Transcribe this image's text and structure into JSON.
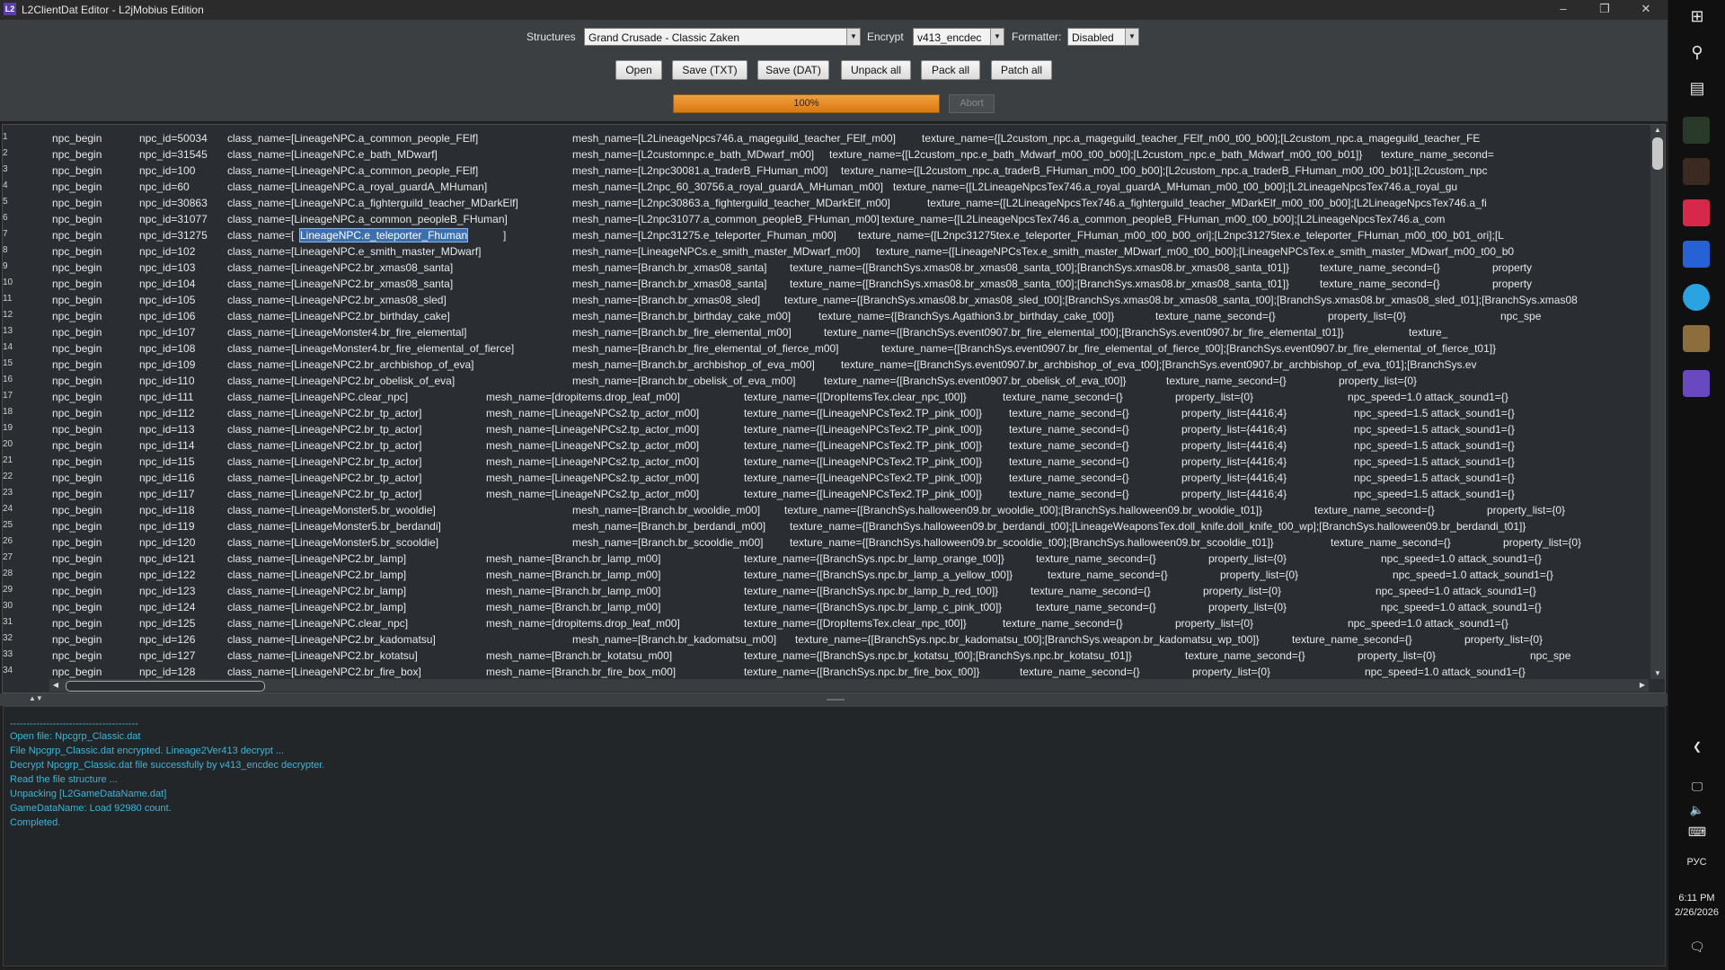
{
  "window": {
    "title": "L2ClientDat Editor - L2jMobius Edition",
    "app_icon": "L2",
    "controls": {
      "minimize": "–",
      "maximize": "❐",
      "close": "✕"
    }
  },
  "toolbar": {
    "structures_label": "Structures",
    "structures_value": "Grand Crusade - Classic Zaken",
    "encrypt_label": "Encrypt",
    "encrypt_value": "v413_encdec",
    "formatter_label": "Formatter:",
    "formatter_value": "Disabled",
    "buttons": [
      "Open",
      "Save (TXT)",
      "Save (DAT)",
      "Unpack all",
      "Pack all",
      "Patch all"
    ],
    "progress_percent": 100,
    "progress_text": "100%",
    "abort_label": "Abort"
  },
  "editor": {
    "highlight_line": 8,
    "highlight_text": "LineageNPC.e_teleporter_Fhuman",
    "lines": [
      {
        "n": "1",
        "a": "npc_begin",
        "b": "npc_id=50034",
        "c": "class_name=[LineageNPC.a_common_people_FElf]",
        "d": "mesh_name=[L2LineageNpcs746.a_mageguild_teacher_FElf_m00]",
        "e": "texture_name={[L2custom_npc.a_mageguild_teacher_FElf_m00_t00_b00];[L2custom_npc.a_mageguild_teacher_FE"
      },
      {
        "n": "2",
        "a": "npc_begin",
        "b": "npc_id=31545",
        "c": "class_name=[LineageNPC.e_bath_MDwarf]",
        "d": "mesh_name=[L2customnpc.e_bath_MDwarf_m00]",
        "e": "texture_name={[L2custom_npc.e_bath_Mdwarf_m00_t00_b00];[L2custom_npc.e_bath_Mdwarf_m00_t00_b01]}",
        "f": "texture_name_second="
      },
      {
        "n": "3",
        "a": "npc_begin",
        "b": "npc_id=100",
        "c": "class_name=[LineageNPC.a_common_people_FElf]",
        "d": "mesh_name=[L2npc30081.a_traderB_FHuman_m00]",
        "e": "texture_name={[L2custom_npc.a_traderB_FHuman_m00_t00_b00];[L2custom_npc.a_traderB_FHuman_m00_t00_b01];[L2custom_npc"
      },
      {
        "n": "4",
        "a": "npc_begin",
        "b": "npc_id=60",
        "c": "class_name=[LineageNPC.a_royal_guardA_MHuman]",
        "d": "mesh_name=[L2npc_60_30756.a_royal_guardA_MHuman_m00]",
        "e": "texture_name={[L2LineageNpcsTex746.a_royal_guardA_MHuman_m00_t00_b00];[L2LineageNpcsTex746.a_royal_gu"
      },
      {
        "n": "5",
        "a": "npc_begin",
        "b": "npc_id=30863",
        "c": "class_name=[LineageNPC.a_fighterguild_teacher_MDarkElf]",
        "d": "mesh_name=[L2npc30863.a_fighterguild_teacher_MDarkElf_m00]",
        "e": "texture_name={[L2LineageNpcsTex746.a_fighterguild_teacher_MDarkElf_m00_t00_b00];[L2LineageNpcsTex746.a_fi"
      },
      {
        "n": "6",
        "a": "npc_begin",
        "b": "npc_id=31077",
        "c": "class_name=[LineageNPC.a_common_peopleB_FHuman]",
        "d": "mesh_name=[L2npc31077.a_common_peopleB_FHuman_m00]",
        "e": "texture_name={[L2LineageNpcsTex746.a_common_peopleB_FHuman_m00_t00_b00];[L2LineageNpcsTex746.a_com"
      },
      {
        "n": "7",
        "a": "npc_begin",
        "b": "npc_id=31275",
        "c": "class_name=[",
        "h": "LineageNPC.e_teleporter_Fhuman",
        "c2": "]",
        "d": "mesh_name=[L2npc31275.e_teleporter_Fhuman_m00]",
        "e": "texture_name={[L2npc31275tex.e_teleporter_FHuman_m00_t00_b00_ori];[L2npc31275tex.e_teleporter_FHuman_m00_t00_b01_ori];[L"
      },
      {
        "n": "8",
        "a": "npc_begin",
        "b": "npc_id=102",
        "c": "class_name=[LineageNPC.e_smith_master_MDwarf]",
        "d": "mesh_name=[LineageNPCs.e_smith_master_MDwarf_m00]",
        "e": "texture_name={[LineageNPCsTex.e_smith_master_MDwarf_m00_t00_b00];[LineageNPCsTex.e_smith_master_MDwarf_m00_t00_b0"
      },
      {
        "n": "9",
        "a": "npc_begin",
        "b": "npc_id=103",
        "c": "class_name=[LineageNPC2.br_xmas08_santa]",
        "d": "mesh_name=[Branch.br_xmas08_santa]",
        "e": "texture_name={[BranchSys.xmas08.br_xmas08_santa_t00];[BranchSys.xmas08.br_xmas08_santa_t01]}",
        "f": "texture_name_second={}",
        "g": "property"
      },
      {
        "n": "10",
        "a": "npc_begin",
        "b": "npc_id=104",
        "c": "class_name=[LineageNPC2.br_xmas08_santa]",
        "d": "mesh_name=[Branch.br_xmas08_santa]",
        "e": "texture_name={[BranchSys.xmas08.br_xmas08_santa_t00];[BranchSys.xmas08.br_xmas08_santa_t01]}",
        "f": "texture_name_second={}",
        "g": "property"
      },
      {
        "n": "11",
        "a": "npc_begin",
        "b": "npc_id=105",
        "c": "class_name=[LineageNPC2.br_xmas08_sled]",
        "d": "mesh_name=[Branch.br_xmas08_sled]",
        "e": "texture_name={[BranchSys.xmas08.br_xmas08_sled_t00];[BranchSys.xmas08.br_xmas08_santa_t00];[BranchSys.xmas08.br_xmas08_sled_t01];[BranchSys.xmas08"
      },
      {
        "n": "12",
        "a": "npc_begin",
        "b": "npc_id=106",
        "c": "class_name=[LineageNPC2.br_birthday_cake]",
        "d": "mesh_name=[Branch.br_birthday_cake_m00]",
        "e": "texture_name={[BranchSys.Agathion3.br_birthday_cake_t00]}",
        "f": "texture_name_second={}",
        "g": "property_list={0}",
        "h2": "npc_spe"
      },
      {
        "n": "13",
        "a": "npc_begin",
        "b": "npc_id=107",
        "c": "class_name=[LineageMonster4.br_fire_elemental]",
        "d": "mesh_name=[Branch.br_fire_elemental_m00]",
        "e": "texture_name={[BranchSys.event0907.br_fire_elemental_t00];[BranchSys.event0907.br_fire_elemental_t01]}",
        "f": "texture_"
      },
      {
        "n": "14",
        "a": "npc_begin",
        "b": "npc_id=108",
        "c": "class_name=[LineageMonster4.br_fire_elemental_of_fierce]",
        "d": "mesh_name=[Branch.br_fire_elemental_of_fierce_m00]",
        "e": "texture_name={[BranchSys.event0907.br_fire_elemental_of_fierce_t00];[BranchSys.event0907.br_fire_elemental_of_fierce_t01]}"
      },
      {
        "n": "15",
        "a": "npc_begin",
        "b": "npc_id=109",
        "c": "class_name=[LineageNPC2.br_archbishop_of_eva]",
        "d": "mesh_name=[Branch.br_archbishop_of_eva_m00]",
        "e": "texture_name={[BranchSys.event0907.br_archbishop_of_eva_t00];[BranchSys.event0907.br_archbishop_of_eva_t01];[BranchSys.ev"
      },
      {
        "n": "16",
        "a": "npc_begin",
        "b": "npc_id=110",
        "c": "class_name=[LineageNPC2.br_obelisk_of_eva]",
        "d": "mesh_name=[Branch.br_obelisk_of_eva_m00]",
        "e": "texture_name={[BranchSys.event0907.br_obelisk_of_eva_t00]}",
        "f": "texture_name_second={}",
        "g": "property_list={0}"
      },
      {
        "n": "17",
        "a": "npc_begin",
        "b": "npc_id=111",
        "c": "class_name=[LineageNPC.clear_npc]",
        "d": "mesh_name=[dropitems.drop_leaf_m00]",
        "e": "texture_name={[DropItemsTex.clear_npc_t00]}",
        "f": "texture_name_second={}",
        "g": "property_list={0}",
        "h2": "npc_speed=1.0 attack_sound1={}"
      },
      {
        "n": "18",
        "a": "npc_begin",
        "b": "npc_id=112",
        "c": "class_name=[LineageNPC2.br_tp_actor]",
        "d": "mesh_name=[LineageNPCs2.tp_actor_m00]",
        "e": "texture_name={[LineageNPCsTex2.TP_pink_t00]}",
        "f": "texture_name_second={}",
        "g": "property_list={4416;4}",
        "h2": "npc_speed=1.5 attack_sound1={}"
      },
      {
        "n": "19",
        "a": "npc_begin",
        "b": "npc_id=113",
        "c": "class_name=[LineageNPC2.br_tp_actor]",
        "d": "mesh_name=[LineageNPCs2.tp_actor_m00]",
        "e": "texture_name={[LineageNPCsTex2.TP_pink_t00]}",
        "f": "texture_name_second={}",
        "g": "property_list={4416;4}",
        "h2": "npc_speed=1.5 attack_sound1={}"
      },
      {
        "n": "20",
        "a": "npc_begin",
        "b": "npc_id=114",
        "c": "class_name=[LineageNPC2.br_tp_actor]",
        "d": "mesh_name=[LineageNPCs2.tp_actor_m00]",
        "e": "texture_name={[LineageNPCsTex2.TP_pink_t00]}",
        "f": "texture_name_second={}",
        "g": "property_list={4416;4}",
        "h2": "npc_speed=1.5 attack_sound1={}"
      },
      {
        "n": "21",
        "a": "npc_begin",
        "b": "npc_id=115",
        "c": "class_name=[LineageNPC2.br_tp_actor]",
        "d": "mesh_name=[LineageNPCs2.tp_actor_m00]",
        "e": "texture_name={[LineageNPCsTex2.TP_pink_t00]}",
        "f": "texture_name_second={}",
        "g": "property_list={4416;4}",
        "h2": "npc_speed=1.5 attack_sound1={}"
      },
      {
        "n": "22",
        "a": "npc_begin",
        "b": "npc_id=116",
        "c": "class_name=[LineageNPC2.br_tp_actor]",
        "d": "mesh_name=[LineageNPCs2.tp_actor_m00]",
        "e": "texture_name={[LineageNPCsTex2.TP_pink_t00]}",
        "f": "texture_name_second={}",
        "g": "property_list={4416;4}",
        "h2": "npc_speed=1.5 attack_sound1={}"
      },
      {
        "n": "23",
        "a": "npc_begin",
        "b": "npc_id=117",
        "c": "class_name=[LineageNPC2.br_tp_actor]",
        "d": "mesh_name=[LineageNPCs2.tp_actor_m00]",
        "e": "texture_name={[LineageNPCsTex2.TP_pink_t00]}",
        "f": "texture_name_second={}",
        "g": "property_list={4416;4}",
        "h2": "npc_speed=1.5 attack_sound1={}"
      },
      {
        "n": "24",
        "a": "npc_begin",
        "b": "npc_id=118",
        "c": "class_name=[LineageMonster5.br_wooldie]",
        "d": "mesh_name=[Branch.br_wooldie_m00]",
        "e": "texture_name={[BranchSys.halloween09.br_wooldie_t00];[BranchSys.halloween09.br_wooldie_t01]}",
        "f": "texture_name_second={}",
        "g": "property_list={0}"
      },
      {
        "n": "25",
        "a": "npc_begin",
        "b": "npc_id=119",
        "c": "class_name=[LineageMonster5.br_berdandi]",
        "d": "mesh_name=[Branch.br_berdandi_m00]",
        "e": "texture_name={[BranchSys.halloween09.br_berdandi_t00];[LineageWeaponsTex.doll_knife.doll_knife_t00_wp];[BranchSys.halloween09.br_berdandi_t01]}"
      },
      {
        "n": "26",
        "a": "npc_begin",
        "b": "npc_id=120",
        "c": "class_name=[LineageMonster5.br_scooldie]",
        "d": "mesh_name=[Branch.br_scooldie_m00]",
        "e": "texture_name={[BranchSys.halloween09.br_scooldie_t00];[BranchSys.halloween09.br_scooldie_t01]}",
        "f": "texture_name_second={}",
        "g": "property_list={0}"
      },
      {
        "n": "27",
        "a": "npc_begin",
        "b": "npc_id=121",
        "c": "class_name=[LineageNPC2.br_lamp]",
        "d": "mesh_name=[Branch.br_lamp_m00]",
        "e": "texture_name={[BranchSys.npc.br_lamp_orange_t00]}",
        "f": "texture_name_second={}",
        "g": "property_list={0}",
        "h2": "npc_speed=1.0 attack_sound1={}"
      },
      {
        "n": "28",
        "a": "npc_begin",
        "b": "npc_id=122",
        "c": "class_name=[LineageNPC2.br_lamp]",
        "d": "mesh_name=[Branch.br_lamp_m00]",
        "e": "texture_name={[BranchSys.npc.br_lamp_a_yellow_t00]}",
        "f": "texture_name_second={}",
        "g": "property_list={0}",
        "h2": "npc_speed=1.0 attack_sound1={}"
      },
      {
        "n": "29",
        "a": "npc_begin",
        "b": "npc_id=123",
        "c": "class_name=[LineageNPC2.br_lamp]",
        "d": "mesh_name=[Branch.br_lamp_m00]",
        "e": "texture_name={[BranchSys.npc.br_lamp_b_red_t00]}",
        "f": "texture_name_second={}",
        "g": "property_list={0}",
        "h2": "npc_speed=1.0 attack_sound1={}"
      },
      {
        "n": "30",
        "a": "npc_begin",
        "b": "npc_id=124",
        "c": "class_name=[LineageNPC2.br_lamp]",
        "d": "mesh_name=[Branch.br_lamp_m00]",
        "e": "texture_name={[BranchSys.npc.br_lamp_c_pink_t00]}",
        "f": "texture_name_second={}",
        "g": "property_list={0}",
        "h2": "npc_speed=1.0 attack_sound1={}"
      },
      {
        "n": "31",
        "a": "npc_begin",
        "b": "npc_id=125",
        "c": "class_name=[LineageNPC.clear_npc]",
        "d": "mesh_name=[dropitems.drop_leaf_m00]",
        "e": "texture_name={[DropItemsTex.clear_npc_t00]}",
        "f": "texture_name_second={}",
        "g": "property_list={0}",
        "h2": "npc_speed=1.0 attack_sound1={}"
      },
      {
        "n": "32",
        "a": "npc_begin",
        "b": "npc_id=126",
        "c": "class_name=[LineageNPC2.br_kadomatsu]",
        "d": "mesh_name=[Branch.br_kadomatsu_m00]",
        "e": "texture_name={[BranchSys.npc.br_kadomatsu_t00];[BranchSys.weapon.br_kadomatsu_wp_t00]}",
        "f": "texture_name_second={}",
        "g": "property_list={0}"
      },
      {
        "n": "33",
        "a": "npc_begin",
        "b": "npc_id=127",
        "c": "class_name=[LineageNPC2.br_kotatsu]",
        "d": "mesh_name=[Branch.br_kotatsu_m00]",
        "e": "texture_name={[BranchSys.npc.br_kotatsu_t00];[BranchSys.npc.br_kotatsu_t01]}",
        "f": "texture_name_second={}",
        "g": "property_list={0}",
        "h2": "npc_spe"
      },
      {
        "n": "34",
        "a": "npc_begin",
        "b": "npc_id=128",
        "c": "class_name=[LineageNPC2.br_fire_box]",
        "d": "mesh_name=[Branch.br_fire_box_m00]",
        "e": "texture_name={[BranchSys.npc.br_fire_box_t00]}",
        "f": "texture_name_second={}",
        "g": "property_list={0}",
        "h2": "npc_speed=1.0 attack_sound1={}"
      }
    ]
  },
  "log": {
    "lines": [
      "---------------------------------------",
      "Open file: Npcgrp_Classic.dat",
      "File Npcgrp_Classic.dat encrypted. Lineage2Ver413 decrypt ...",
      "Decrypt Npcgrp_Classic.dat file successfully by v413_encdec decrypter.",
      "Read the file structure ...",
      "Unpacking [L2GameDataName.dat]",
      "GameDataName: Load 92980 count.",
      "Completed."
    ],
    "color": "#3fb4d6"
  },
  "taskbar": {
    "language": "РУС",
    "time": "6:11 PM",
    "date": "2/26/2026",
    "icons": [
      "windows-icon",
      "search-icon",
      "task-view-icon",
      "app-icon-1",
      "app-icon-2",
      "app-icon-3",
      "app-icon-4",
      "telegram-icon",
      "app-icon-5",
      "l2-editor-icon"
    ]
  }
}
